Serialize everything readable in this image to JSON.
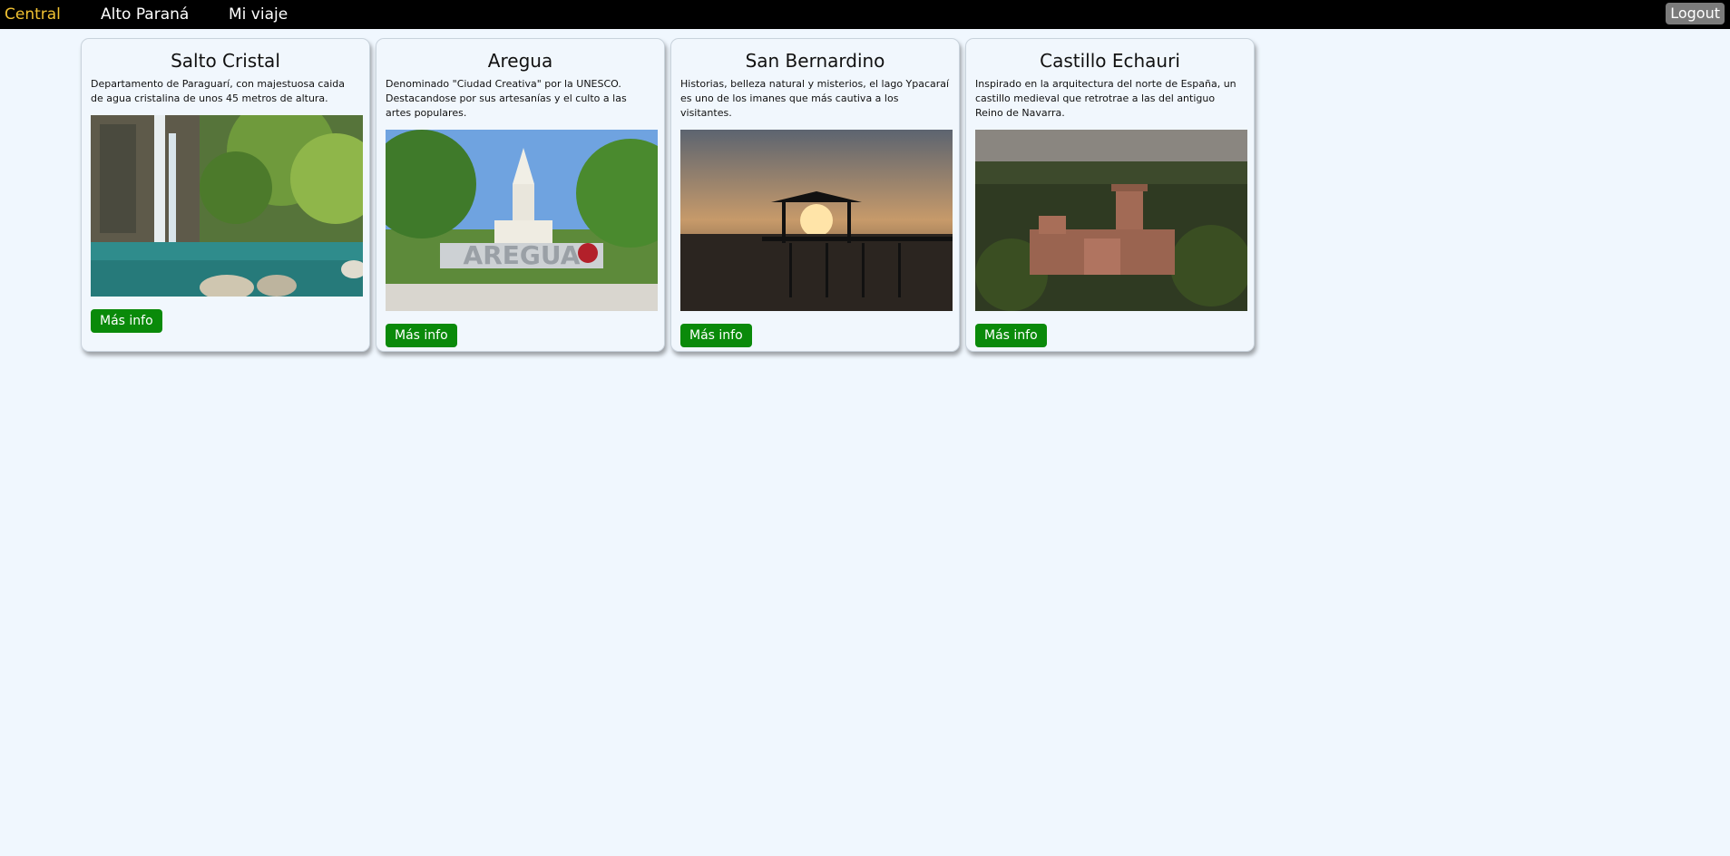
{
  "nav": {
    "links": [
      {
        "label": "Central",
        "active": true
      },
      {
        "label": "Alto Paraná",
        "active": false
      },
      {
        "label": "Mi viaje",
        "active": false
      }
    ],
    "logout_label": "Logout",
    "active_color": "#f1c232"
  },
  "cards": [
    {
      "title": "Salto Cristal",
      "description": "Departamento de Paraguarí, con majestuosa caida de agua cristalina de unos 45 metros de altura.",
      "image": "waterfall-photo",
      "button_label": "Más info"
    },
    {
      "title": "Aregua",
      "description": "Denominado \"Ciudad Creativa\" por la UNESCO. Destacandose por sus artesanías y el culto a las artes populares.",
      "image": "aregua-church-photo",
      "image_text": "AREGUA",
      "button_label": "Más info"
    },
    {
      "title": "San Bernardino",
      "description": "Historias, belleza natural y misterios, el lago Ypacaraí es uno de los imanes que más cautiva a los visitantes.",
      "image": "lake-sunset-pier-photo",
      "button_label": "Más info"
    },
    {
      "title": "Castillo Echauri",
      "description": "Inspirado en la arquitectura del norte de España, un castillo medieval que retrotrae a las del antiguo Reino de Navarra.",
      "image": "castle-aerial-photo",
      "button_label": "Más info"
    }
  ],
  "colors": {
    "background": "#f0f7fe",
    "navbar": "#000000",
    "button": "#0a8a0a",
    "logout": "#7b7b7b"
  }
}
